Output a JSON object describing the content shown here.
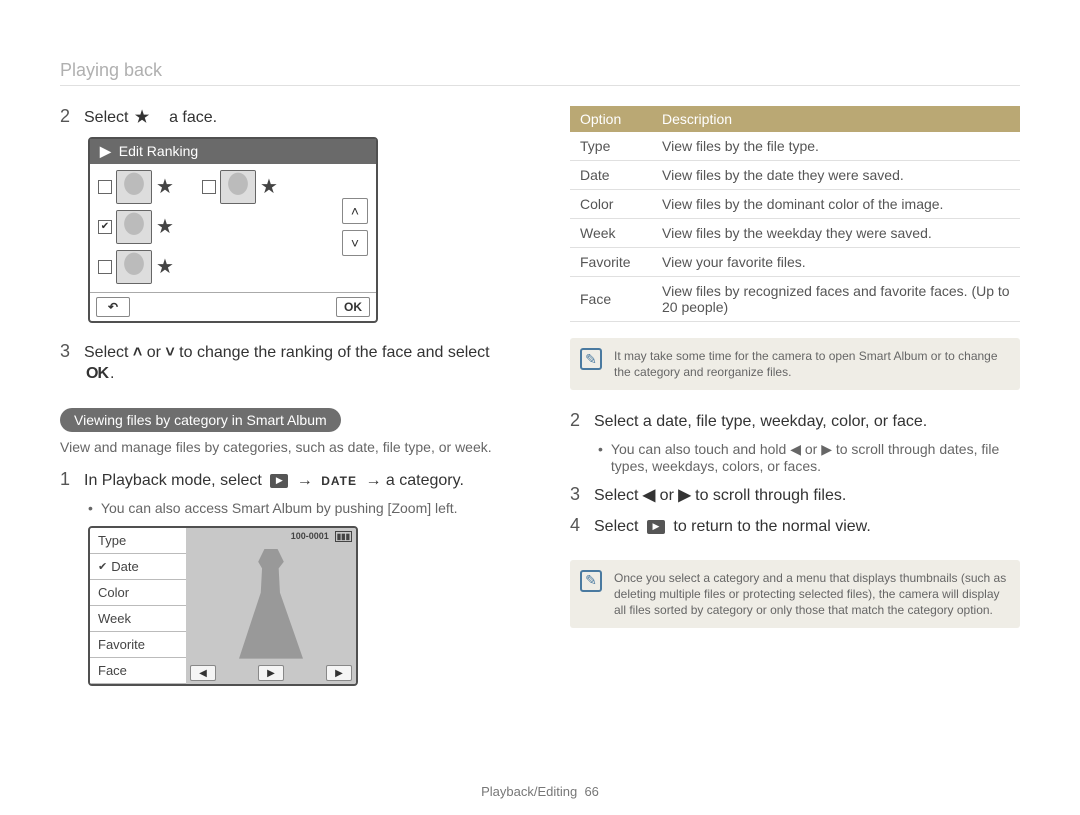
{
  "header_title": "Playing back",
  "left": {
    "step2": {
      "num": "2",
      "prefix": "Select",
      "suffix": "a face.",
      "icon_name": "star-icon"
    },
    "edit_screen": {
      "play_icon": "▶",
      "title": "Edit Ranking",
      "faces": [
        {
          "checked": false,
          "star": "★"
        },
        {
          "checked": false,
          "star": "★"
        },
        {
          "checked": true,
          "star": "★"
        },
        {
          "checked": false,
          "star": "★"
        }
      ],
      "back": "↶",
      "ok": "OK"
    },
    "step3": {
      "num": "3",
      "text_before": "Select ",
      "up": "˄",
      "or": " or ",
      "down": "˅",
      "text_after": " to change the ranking of the face and select",
      "ok": "OK",
      "period": "."
    },
    "section_label": "Viewing files by category in Smart Album",
    "section_body": "View and manage files by categories, such as date, file type, or week.",
    "step1b": {
      "num": "1",
      "prefix": "In Playback mode, select",
      "play": "▶",
      "arrow": "→",
      "date": "DATE",
      "arrow2": "→",
      "suffix": "a category."
    },
    "bullet1b": "You can also access Smart Album by pushing [Zoom] left.",
    "album_screen": {
      "menu": [
        "Type",
        "Date",
        "Color",
        "Week",
        "Favorite",
        "Face"
      ],
      "selected": "Date",
      "counter": "100-0001",
      "batt": "▮▮▮",
      "back": "◀",
      "play": "▶",
      "fwd": "▶"
    }
  },
  "right": {
    "table": {
      "h1": "Option",
      "h2": "Description",
      "rows": [
        [
          "Type",
          "View files by the file type."
        ],
        [
          "Date",
          "View files by the date they were saved."
        ],
        [
          "Color",
          "View files by the dominant color of the image."
        ],
        [
          "Week",
          "View files by the weekday they were saved."
        ],
        [
          "Favorite",
          "View your favorite files."
        ],
        [
          "Face",
          "View files by recognized faces and favorite faces. (Up to 20 people)"
        ]
      ]
    },
    "note1": "It may take some time for the camera to open Smart Album or to change the category and reorganize files.",
    "step2b": {
      "num": "2",
      "text": "Select a date, ﬁle type, weekday, color, or face."
    },
    "bullet2b": "You can also touch and hold ◀ or ▶ to scroll through dates, file types, weekdays, colors, or faces.",
    "step3b": {
      "num": "3",
      "prefix": "Select ",
      "left": "◀",
      "or": " or ",
      "right": "▶",
      "suffix": " to scroll through ﬁles."
    },
    "step4b": {
      "num": "4",
      "prefix": "Select ",
      "play": "▶",
      "suffix": " to return to the normal view."
    },
    "note2": "Once you select a category and a menu that displays thumbnails (such as deleting multiple files or protecting selected files), the camera will display all files sorted by category or only those that match the category option."
  },
  "footer": {
    "section": "Playback/Editing",
    "page": "66"
  }
}
